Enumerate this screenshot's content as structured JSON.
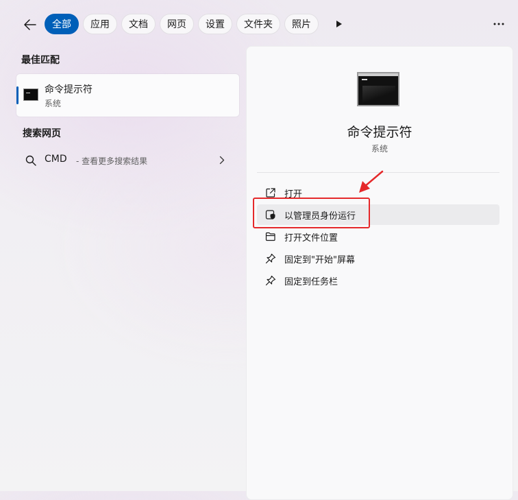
{
  "filters": {
    "back_icon": "back-arrow-icon",
    "chips": [
      {
        "label": "全部",
        "active": true
      },
      {
        "label": "应用",
        "active": false
      },
      {
        "label": "文档",
        "active": false
      },
      {
        "label": "网页",
        "active": false
      },
      {
        "label": "设置",
        "active": false
      },
      {
        "label": "文件夹",
        "active": false
      },
      {
        "label": "照片",
        "active": false
      }
    ],
    "play_icon": "play-icon",
    "more_icon": "more-ellipsis-icon",
    "accent_color": "#005fb8"
  },
  "best_match": {
    "section_title": "最佳匹配",
    "name": "命令提示符",
    "type": "系统",
    "icon": "command-prompt-icon"
  },
  "web_search": {
    "section_title": "搜索网页",
    "query": "CMD",
    "hint": "- 查看更多搜索结果",
    "icon": "search-icon",
    "chevron": "chevron-right-icon"
  },
  "detail": {
    "title": "命令提示符",
    "subtitle": "系统",
    "icon": "command-prompt-icon",
    "actions": [
      {
        "label": "打开",
        "icon": "open-external-icon"
      },
      {
        "label": "以管理员身份运行",
        "icon": "shield-admin-icon",
        "highlighted": true
      },
      {
        "label": "打开文件位置",
        "icon": "folder-icon"
      },
      {
        "label": "固定到\"开始\"屏幕",
        "icon": "pin-icon"
      },
      {
        "label": "固定到任务栏",
        "icon": "pin-icon"
      }
    ]
  },
  "annotation": {
    "color": "#e5282a",
    "target": "以管理员身份运行"
  }
}
